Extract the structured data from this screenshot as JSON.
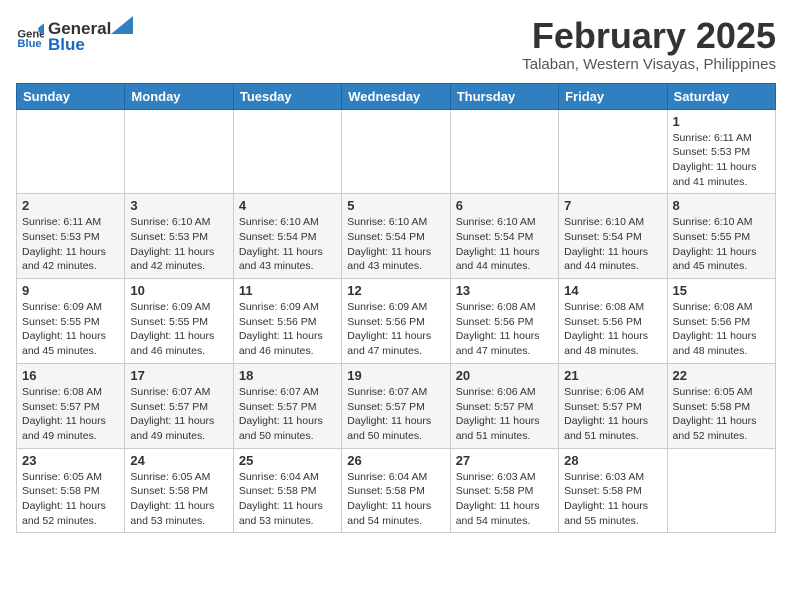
{
  "logo": {
    "general": "General",
    "blue": "Blue"
  },
  "title": "February 2025",
  "subtitle": "Talaban, Western Visayas, Philippines",
  "weekdays": [
    "Sunday",
    "Monday",
    "Tuesday",
    "Wednesday",
    "Thursday",
    "Friday",
    "Saturday"
  ],
  "weeks": [
    [
      {
        "day": "",
        "info": ""
      },
      {
        "day": "",
        "info": ""
      },
      {
        "day": "",
        "info": ""
      },
      {
        "day": "",
        "info": ""
      },
      {
        "day": "",
        "info": ""
      },
      {
        "day": "",
        "info": ""
      },
      {
        "day": "1",
        "info": "Sunrise: 6:11 AM\nSunset: 5:53 PM\nDaylight: 11 hours\nand 41 minutes."
      }
    ],
    [
      {
        "day": "2",
        "info": "Sunrise: 6:11 AM\nSunset: 5:53 PM\nDaylight: 11 hours\nand 42 minutes."
      },
      {
        "day": "3",
        "info": "Sunrise: 6:10 AM\nSunset: 5:53 PM\nDaylight: 11 hours\nand 42 minutes."
      },
      {
        "day": "4",
        "info": "Sunrise: 6:10 AM\nSunset: 5:54 PM\nDaylight: 11 hours\nand 43 minutes."
      },
      {
        "day": "5",
        "info": "Sunrise: 6:10 AM\nSunset: 5:54 PM\nDaylight: 11 hours\nand 43 minutes."
      },
      {
        "day": "6",
        "info": "Sunrise: 6:10 AM\nSunset: 5:54 PM\nDaylight: 11 hours\nand 44 minutes."
      },
      {
        "day": "7",
        "info": "Sunrise: 6:10 AM\nSunset: 5:54 PM\nDaylight: 11 hours\nand 44 minutes."
      },
      {
        "day": "8",
        "info": "Sunrise: 6:10 AM\nSunset: 5:55 PM\nDaylight: 11 hours\nand 45 minutes."
      }
    ],
    [
      {
        "day": "9",
        "info": "Sunrise: 6:09 AM\nSunset: 5:55 PM\nDaylight: 11 hours\nand 45 minutes."
      },
      {
        "day": "10",
        "info": "Sunrise: 6:09 AM\nSunset: 5:55 PM\nDaylight: 11 hours\nand 46 minutes."
      },
      {
        "day": "11",
        "info": "Sunrise: 6:09 AM\nSunset: 5:56 PM\nDaylight: 11 hours\nand 46 minutes."
      },
      {
        "day": "12",
        "info": "Sunrise: 6:09 AM\nSunset: 5:56 PM\nDaylight: 11 hours\nand 47 minutes."
      },
      {
        "day": "13",
        "info": "Sunrise: 6:08 AM\nSunset: 5:56 PM\nDaylight: 11 hours\nand 47 minutes."
      },
      {
        "day": "14",
        "info": "Sunrise: 6:08 AM\nSunset: 5:56 PM\nDaylight: 11 hours\nand 48 minutes."
      },
      {
        "day": "15",
        "info": "Sunrise: 6:08 AM\nSunset: 5:56 PM\nDaylight: 11 hours\nand 48 minutes."
      }
    ],
    [
      {
        "day": "16",
        "info": "Sunrise: 6:08 AM\nSunset: 5:57 PM\nDaylight: 11 hours\nand 49 minutes."
      },
      {
        "day": "17",
        "info": "Sunrise: 6:07 AM\nSunset: 5:57 PM\nDaylight: 11 hours\nand 49 minutes."
      },
      {
        "day": "18",
        "info": "Sunrise: 6:07 AM\nSunset: 5:57 PM\nDaylight: 11 hours\nand 50 minutes."
      },
      {
        "day": "19",
        "info": "Sunrise: 6:07 AM\nSunset: 5:57 PM\nDaylight: 11 hours\nand 50 minutes."
      },
      {
        "day": "20",
        "info": "Sunrise: 6:06 AM\nSunset: 5:57 PM\nDaylight: 11 hours\nand 51 minutes."
      },
      {
        "day": "21",
        "info": "Sunrise: 6:06 AM\nSunset: 5:57 PM\nDaylight: 11 hours\nand 51 minutes."
      },
      {
        "day": "22",
        "info": "Sunrise: 6:05 AM\nSunset: 5:58 PM\nDaylight: 11 hours\nand 52 minutes."
      }
    ],
    [
      {
        "day": "23",
        "info": "Sunrise: 6:05 AM\nSunset: 5:58 PM\nDaylight: 11 hours\nand 52 minutes."
      },
      {
        "day": "24",
        "info": "Sunrise: 6:05 AM\nSunset: 5:58 PM\nDaylight: 11 hours\nand 53 minutes."
      },
      {
        "day": "25",
        "info": "Sunrise: 6:04 AM\nSunset: 5:58 PM\nDaylight: 11 hours\nand 53 minutes."
      },
      {
        "day": "26",
        "info": "Sunrise: 6:04 AM\nSunset: 5:58 PM\nDaylight: 11 hours\nand 54 minutes."
      },
      {
        "day": "27",
        "info": "Sunrise: 6:03 AM\nSunset: 5:58 PM\nDaylight: 11 hours\nand 54 minutes."
      },
      {
        "day": "28",
        "info": "Sunrise: 6:03 AM\nSunset: 5:58 PM\nDaylight: 11 hours\nand 55 minutes."
      },
      {
        "day": "",
        "info": ""
      }
    ]
  ]
}
